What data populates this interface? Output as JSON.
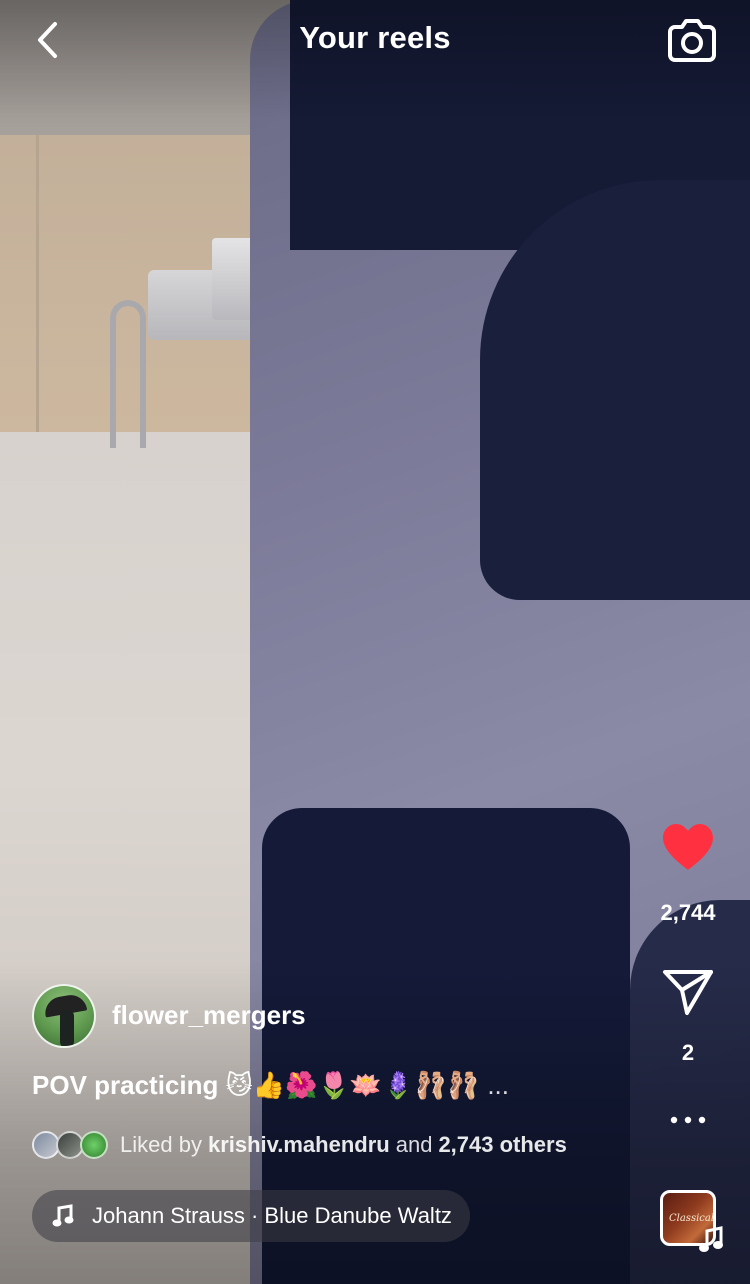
{
  "header": {
    "title": "Your reels",
    "back_icon": "chevron-left-icon",
    "camera_icon": "camera-icon"
  },
  "actions": {
    "like_icon": "heart-filled-icon",
    "like_color": "#ff3040",
    "like_count": "2,744",
    "share_icon": "paper-plane-icon",
    "share_count": "2",
    "more_icon": "more-horizontal-icon",
    "music_thumb_text": "Classical"
  },
  "post": {
    "username": "flower_mergers",
    "caption": "POV practicing 😼👍🌺🌷🪷🪻🩰🩰",
    "caption_more": "...",
    "liked_prefix": "Liked by",
    "liked_by": "krishiv.mahendru",
    "liked_and": "and",
    "liked_others": "2,743 others"
  },
  "audio": {
    "icon": "music-note-icon",
    "label": "Johann Strauss · Blue Danube Waltz"
  }
}
